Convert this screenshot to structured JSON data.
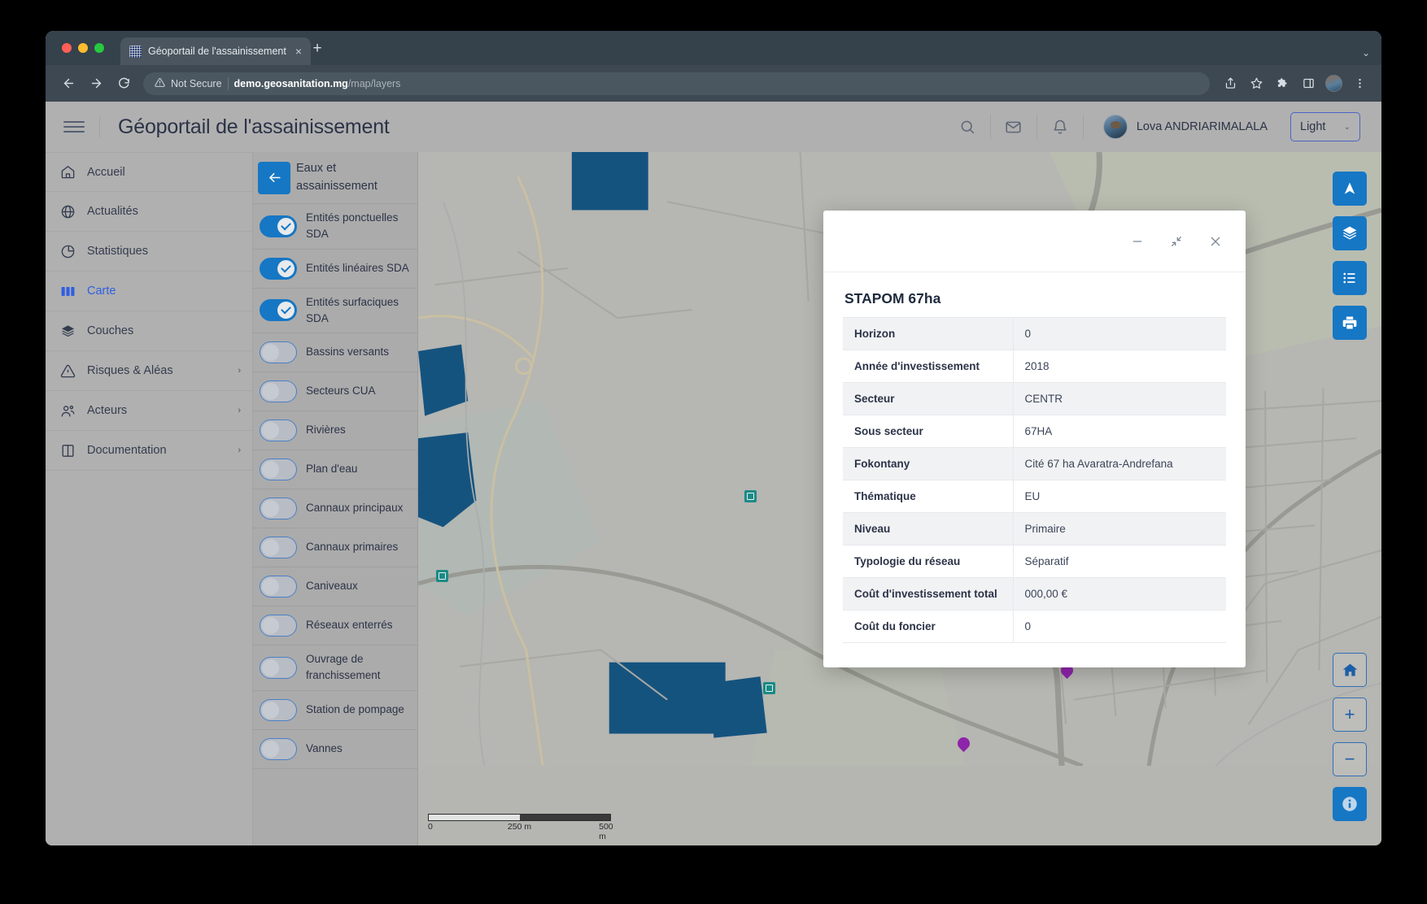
{
  "browser": {
    "tab_title": "Géoportail de l'assainissement",
    "tab_favicon": "grid-favicon",
    "tab_close": "×",
    "new_tab": "+",
    "tab_list_chevron": "⌄",
    "back": "←",
    "forward": "→",
    "reload": "⟳",
    "security_icon": "warning-triangle-icon",
    "security_label": "Not Secure",
    "url_host": "demo.geosanitation.mg",
    "url_path": "/map/layers",
    "share_icon": "share-icon",
    "bookmark_icon": "star-icon",
    "extensions_icon": "puzzle-icon",
    "sidepanel_icon": "side-panel-icon",
    "menu_icon": "kebab-menu-icon"
  },
  "header": {
    "menu_toggle": "hamburger-icon",
    "title": "Géoportail de l'assainissement",
    "search_icon": "search-icon",
    "mail_icon": "mail-icon",
    "bell_icon": "bell-icon",
    "user_name": "Lova ANDRIARIMALALA",
    "theme": {
      "value": "Light",
      "chevron": "⌄"
    }
  },
  "sidebar": {
    "items": [
      {
        "label": "Accueil",
        "icon": "home-icon",
        "active": false,
        "chevron": ""
      },
      {
        "label": "Actualités",
        "icon": "globe-icon",
        "active": false,
        "chevron": ""
      },
      {
        "label": "Statistiques",
        "icon": "pie-chart-icon",
        "active": false,
        "chevron": ""
      },
      {
        "label": "Carte",
        "icon": "map-icon",
        "active": true,
        "chevron": ""
      },
      {
        "label": "Couches",
        "icon": "layers-icon",
        "active": false,
        "chevron": ""
      },
      {
        "label": "Risques & Aléas",
        "icon": "warning-icon",
        "active": false,
        "chevron": "›"
      },
      {
        "label": "Acteurs",
        "icon": "users-icon",
        "active": false,
        "chevron": "›"
      },
      {
        "label": "Documentation",
        "icon": "book-icon",
        "active": false,
        "chevron": "›"
      }
    ]
  },
  "layers_panel": {
    "back_icon": "arrow-left-icon",
    "title": "Eaux et assainissement",
    "layers": [
      {
        "label": "Entités ponctuelles SDA",
        "on": true
      },
      {
        "label": "Entités linéaires SDA",
        "on": true
      },
      {
        "label": "Entités surfaciques SDA",
        "on": true
      },
      {
        "label": "Bassins versants",
        "on": false
      },
      {
        "label": "Secteurs CUA",
        "on": false
      },
      {
        "label": "Rivières",
        "on": false
      },
      {
        "label": "Plan d'eau",
        "on": false
      },
      {
        "label": "Cannaux principaux",
        "on": false
      },
      {
        "label": "Cannaux primaires",
        "on": false
      },
      {
        "label": "Caniveaux",
        "on": false
      },
      {
        "label": "Réseaux enterrés",
        "on": false
      },
      {
        "label": "Ouvrage de franchissement",
        "on": false
      },
      {
        "label": "Station de pompage",
        "on": false
      },
      {
        "label": "Vannes",
        "on": false
      }
    ]
  },
  "map": {
    "controls_top": [
      {
        "name": "locate-button",
        "icon": "navigation-arrow-icon",
        "style": "solid"
      },
      {
        "name": "basemap-button",
        "icon": "layers-icon",
        "style": "solid"
      },
      {
        "name": "legend-button",
        "icon": "list-icon",
        "style": "solid"
      },
      {
        "name": "print-button",
        "icon": "printer-icon",
        "style": "solid"
      }
    ],
    "controls_bottom": [
      {
        "name": "home-extent-button",
        "icon": "home-icon",
        "style": "ghost",
        "glyph": ""
      },
      {
        "name": "zoom-in-button",
        "icon": "plus-icon",
        "style": "ghost",
        "glyph": "+"
      },
      {
        "name": "zoom-out-button",
        "icon": "minus-icon",
        "style": "ghost",
        "glyph": "−"
      },
      {
        "name": "info-button",
        "icon": "info-icon",
        "style": "solid",
        "glyph": "i"
      }
    ],
    "scale": {
      "zero": "0",
      "mid": "250 m",
      "max": "500 m"
    }
  },
  "modal": {
    "minimize_icon": "minimize-icon",
    "collapse_icon": "collapse-arrows-icon",
    "close_icon": "close-icon",
    "heading": "STAPOM 67ha",
    "attributes": [
      {
        "key": "Horizon",
        "value": "0"
      },
      {
        "key": "Année d'investissement",
        "value": "2018"
      },
      {
        "key": "Secteur",
        "value": "CENTR"
      },
      {
        "key": "Sous secteur",
        "value": "67HA"
      },
      {
        "key": "Fokontany",
        "value": "Cité 67 ha Avaratra-Andrefana"
      },
      {
        "key": "Thématique",
        "value": "EU"
      },
      {
        "key": "Niveau",
        "value": "Primaire"
      },
      {
        "key": "Typologie du réseau",
        "value": "Séparatif"
      },
      {
        "key": "Coût d'investissement total",
        "value": "000,00 €"
      },
      {
        "key": "Coût du foncier",
        "value": "0"
      }
    ]
  },
  "colors": {
    "accent_blue": "#1677c4",
    "active_nav": "#2f5fe0",
    "water_polygon": "#15537f",
    "chrome_dark": "#35414b",
    "app_bg": "#b0b0b0"
  }
}
